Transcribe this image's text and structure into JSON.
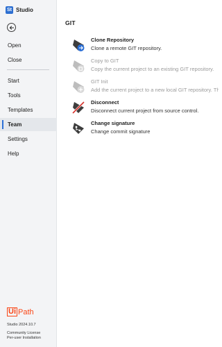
{
  "app": {
    "title": "Studio",
    "logo_text": "St"
  },
  "sidebar": {
    "items": [
      {
        "label": "Open"
      },
      {
        "label": "Close"
      },
      {
        "label": "Start"
      },
      {
        "label": "Tools"
      },
      {
        "label": "Templates"
      },
      {
        "label": "Team",
        "active": true
      },
      {
        "label": "Settings"
      },
      {
        "label": "Help"
      }
    ],
    "brand": {
      "ui": "Ui",
      "path": "Path"
    },
    "version": "Studio 2024.10.7",
    "license": [
      "Community License",
      "Per-user Installation"
    ]
  },
  "main": {
    "section_title": "GIT",
    "actions": [
      {
        "title": "Clone Repository",
        "description": "Clone a remote GIT repository.",
        "icon": "clone-repository-icon",
        "enabled": true
      },
      {
        "title": "Copy to GIT",
        "description": "Copy the current project to an existing GIT repository.",
        "icon": "copy-to-git-icon",
        "enabled": false
      },
      {
        "title": "GIT Init",
        "description": "Add the current project to a new local GIT repository. The re",
        "icon": "git-init-icon",
        "enabled": false
      },
      {
        "title": "Disconnect",
        "description": "Disconnect current project from source control.",
        "icon": "disconnect-icon",
        "enabled": true
      },
      {
        "title": "Change signature",
        "description": "Change commit signature",
        "icon": "change-signature-icon",
        "enabled": true
      }
    ]
  },
  "colors": {
    "accent": "#2b6fd6",
    "brand": "#fa4616",
    "sidebar_bg": "#f3f4f6",
    "disabled_text": "#9a9a9a"
  }
}
